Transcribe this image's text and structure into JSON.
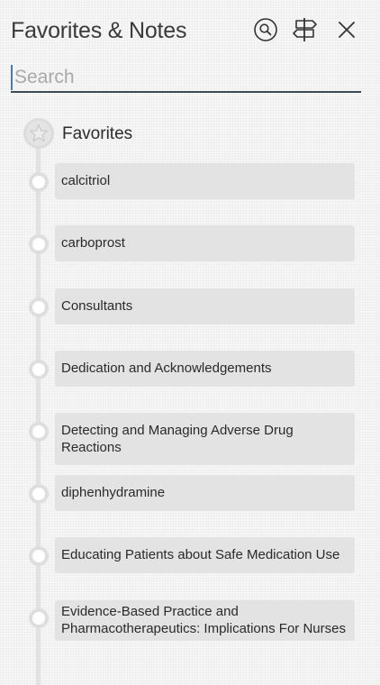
{
  "header": {
    "title": "Favorites & Notes",
    "icons": [
      "search-icon",
      "signpost-icon",
      "close-icon"
    ]
  },
  "search": {
    "placeholder": "Search",
    "value": ""
  },
  "favorites": {
    "section_label": "Favorites",
    "section_icon": "star-icon",
    "items": [
      {
        "label": "calcitriol"
      },
      {
        "label": "carboprost"
      },
      {
        "label": "Consultants"
      },
      {
        "label": "Dedication and Acknowledgements"
      },
      {
        "label": "Detecting and Managing Adverse Drug Reactions"
      },
      {
        "label": "diphenhydramine"
      },
      {
        "label": "Educating Patients about Safe Medication Use"
      },
      {
        "label": "Evidence-Based Practice and Pharmacotherapeutics: Implications For Nurses"
      }
    ]
  },
  "colors": {
    "background": "#f6f6f6",
    "item_background": "#e3e3e3",
    "timeline": "#e2e2e2",
    "search_underline": "#3c4a55"
  }
}
